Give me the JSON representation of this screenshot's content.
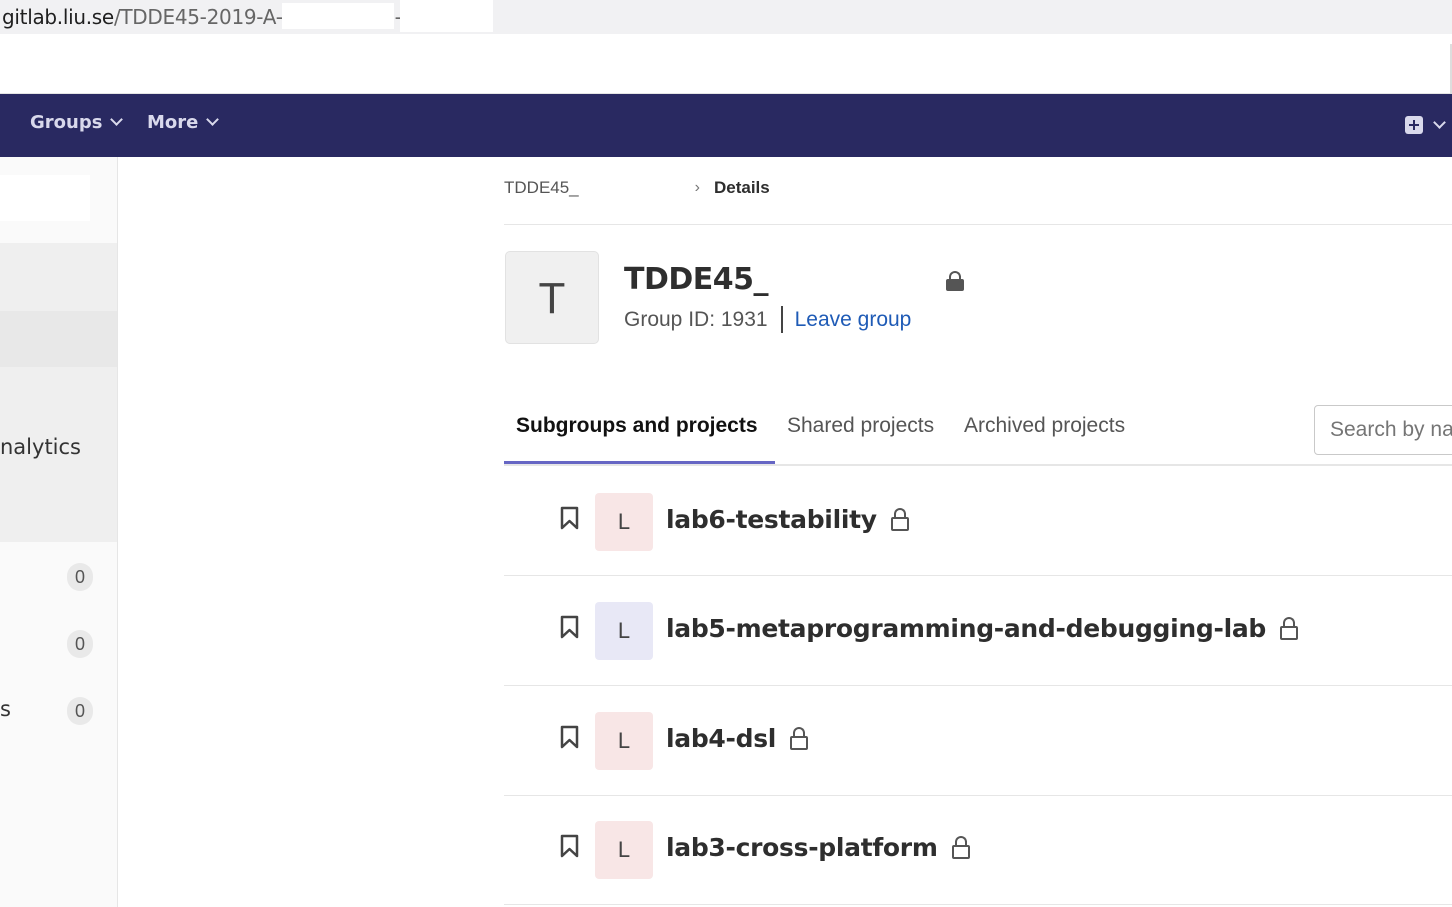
{
  "browser": {
    "url_host": "gitlab.liu.se",
    "url_path": "/TDDE45-2019-A-",
    "url_tail": "-"
  },
  "topnav": {
    "items": [
      {
        "label": "Groups"
      },
      {
        "label": "More"
      }
    ],
    "accent_color": "#292961"
  },
  "sidebar": {
    "partial_label_1": "nalytics",
    "partial_label_2": "s",
    "counts": [
      "0",
      "0",
      "0"
    ]
  },
  "breadcrumb": {
    "group": "TDDE45_",
    "current": "Details"
  },
  "group": {
    "avatar_letter": "T",
    "title": "TDDE45_",
    "group_id": "Group ID: 1931",
    "leave_label": "Leave group",
    "visibility_icon": "lock-icon"
  },
  "tabs": [
    {
      "label": "Subgroups and projects",
      "active": true
    },
    {
      "label": "Shared projects",
      "active": false
    },
    {
      "label": "Archived projects",
      "active": false
    }
  ],
  "search": {
    "placeholder": "Search by name"
  },
  "projects": [
    {
      "avatar_letter": "L",
      "name": "lab6-testability",
      "avatar_color": "#f8e6e6"
    },
    {
      "avatar_letter": "L",
      "name": "lab5-metaprogramming-and-debugging-lab",
      "avatar_color": "#e8e8f6"
    },
    {
      "avatar_letter": "L",
      "name": "lab4-dsl",
      "avatar_color": "#f8e6e6"
    },
    {
      "avatar_letter": "L",
      "name": "lab3-cross-platform",
      "avatar_color": "#f8e6e6"
    }
  ]
}
